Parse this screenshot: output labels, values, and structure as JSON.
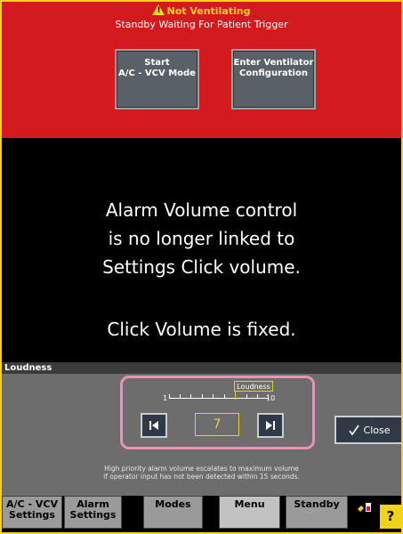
{
  "banner": {
    "alarm": "Not Ventilating",
    "status": "Standby Waiting For Patient Trigger",
    "buttons": [
      {
        "line1": "Start",
        "line2": "A/C - VCV Mode"
      },
      {
        "line1": "Enter Ventilator",
        "line2": "Configuration"
      }
    ]
  },
  "message": {
    "lines1": [
      "Alarm Volume control",
      "is no longer linked to",
      "Settings Click volume."
    ],
    "line2": "Click Volume is fixed."
  },
  "loudness": {
    "title": "Loudness",
    "scale_min": "1",
    "scale_max": "10",
    "scale_label": "Loudness",
    "value": "7",
    "level": 0.67,
    "close_label": "Close",
    "note_line1": "High priority alarm volume escalates to maximum volume",
    "note_line2": "if operator input has not been detected within 15 seconds."
  },
  "tabs": [
    {
      "line1": "A/C - VCV",
      "line2": "Settings"
    },
    {
      "line1": "Alarm",
      "line2": "Settings"
    },
    {
      "line1": "Modes",
      "line2": ""
    },
    {
      "line1": "Menu",
      "line2": ""
    },
    {
      "line1": "Standby",
      "line2": ""
    }
  ],
  "help_label": "?",
  "colors": {
    "alarm_red": "#d21a1f",
    "warning_yellow": "#ffd21c",
    "highlight_pink": "#ef8fb4"
  }
}
